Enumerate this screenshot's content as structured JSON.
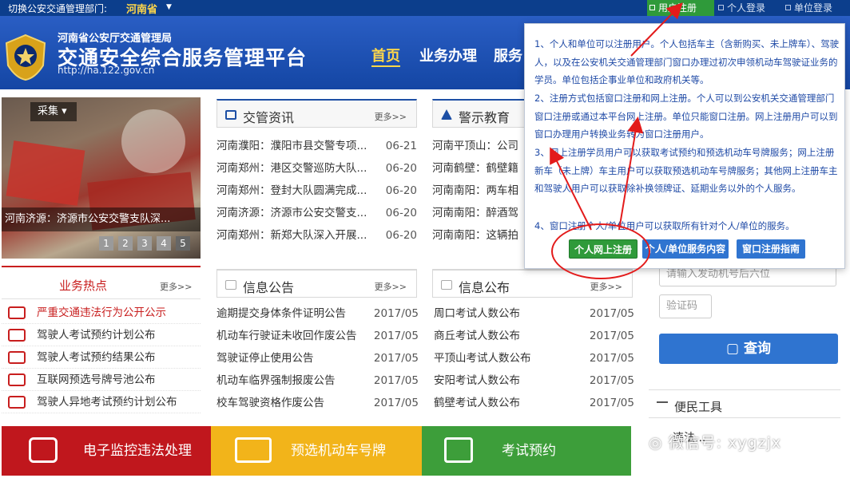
{
  "topbar": {
    "switch_label": "切换公安交通管理部门:",
    "province": "河南省",
    "register": "用户注册",
    "personal_login": "个人登录",
    "unit_login": "单位登录"
  },
  "header": {
    "subtitle": "河南省公安厅交通管理局",
    "title": "交通安全综合服务管理平台",
    "url": "http://ha.122.gov.cn",
    "nav": [
      "首页",
      "业务办理",
      "服务"
    ]
  },
  "slideshow": {
    "tag": "采集",
    "caption": "河南济源：济源市公安交警支队深...",
    "pages": [
      "1",
      "2",
      "3",
      "4",
      "5"
    ]
  },
  "news": {
    "title": "交管资讯",
    "more": "更多>>",
    "items": [
      {
        "text": "河南濮阳：濮阳市县交警专项...",
        "date": "06-21"
      },
      {
        "text": "河南郑州：港区交警巡防大队...",
        "date": "06-20"
      },
      {
        "text": "河南郑州：登封大队圆满完成...",
        "date": "06-20"
      },
      {
        "text": "河南济源：济源市公安交警支...",
        "date": "06-20"
      },
      {
        "text": "河南郑州：新郑大队深入开展...",
        "date": "06-20"
      }
    ]
  },
  "warning": {
    "title": "警示教育",
    "items": [
      "河南平顶山：公司",
      "河南鹤壁：鹤壁籍",
      "河南南阳：两车相",
      "河南南阳：醉酒驾",
      "河南南阳：这辆拍"
    ]
  },
  "hot": {
    "title": "业务热点",
    "more": "更多>>",
    "items": [
      "严重交通违法行为公开公示",
      "驾驶人考试预约计划公布",
      "驾驶人考试预约结果公布",
      "互联网预选号牌号池公布",
      "驾驶人异地考试预约计划公布"
    ]
  },
  "info": {
    "title": "信息公告",
    "more": "更多>>",
    "items": [
      {
        "text": "逾期提交身体条件证明公告",
        "date": "2017/05"
      },
      {
        "text": "机动车行驶证未收回作废公告",
        "date": "2017/05"
      },
      {
        "text": "驾驶证停止使用公告",
        "date": "2017/05"
      },
      {
        "text": "机动车临界强制报废公告",
        "date": "2017/05"
      },
      {
        "text": "校车驾驶资格作废公告",
        "date": "2017/05"
      }
    ]
  },
  "release": {
    "title": "信息公布",
    "more": "更多>>",
    "items": [
      {
        "text": "周口考试人数公布",
        "date": "2017/05"
      },
      {
        "text": "商丘考试人数公布",
        "date": "2017/05"
      },
      {
        "text": "平顶山考试人数公布",
        "date": "2017/05"
      },
      {
        "text": "安阳考试人数公布",
        "date": "2017/05"
      },
      {
        "text": "鹤壁考试人数公布",
        "date": "2017/05"
      }
    ]
  },
  "bottom": [
    "电子监控违法处理",
    "预选机动车号牌",
    "考试预约"
  ],
  "popup": {
    "p1": "1、个人和单位可以注册用户。个人包括车主（含新购买、未上牌车）、驾驶人，以及在公安机关交通管理部门窗口办理过初次申领机动车驾驶证业务的学员。单位包括企事业单位和政府机关等。",
    "p2": "2、注册方式包括窗口注册和网上注册。个人可以到公安机关交通管理部门窗口注册或通过本平台网上注册。单位只能窗口注册。网上注册用户可以到窗口办理用户转换业务转为窗口注册用户。",
    "p3": "3、网上注册学员用户可以获取考试预约和预选机动车号牌服务；网上注册新车（未上牌）车主用户可以获取预选机动车号牌服务；其他网上注册车主和驾驶人用户可以获取除补换领牌证、延期业务以外的个人服务。",
    "p4": "4、窗口注册个人/单位用户可以获取所有针对个人/单位的服务。",
    "btn_online": "个人网上注册",
    "btn_content": "个人/单位服务内容",
    "btn_guide": "窗口注册指南"
  },
  "query": {
    "engine_placeholder": "请输入发动机号后六位",
    "captcha_placeholder": "验证码",
    "button": "查询"
  },
  "tools": {
    "title": "便民工具",
    "partial": "违法..."
  },
  "watermark": {
    "text": "微信号: xygzjx"
  },
  "colors": {
    "brand_blue": "#1446a4",
    "accent_yellow": "#ffd74a",
    "red": "#c0171d",
    "green": "#3d9e3a",
    "orange": "#f2b41a"
  }
}
